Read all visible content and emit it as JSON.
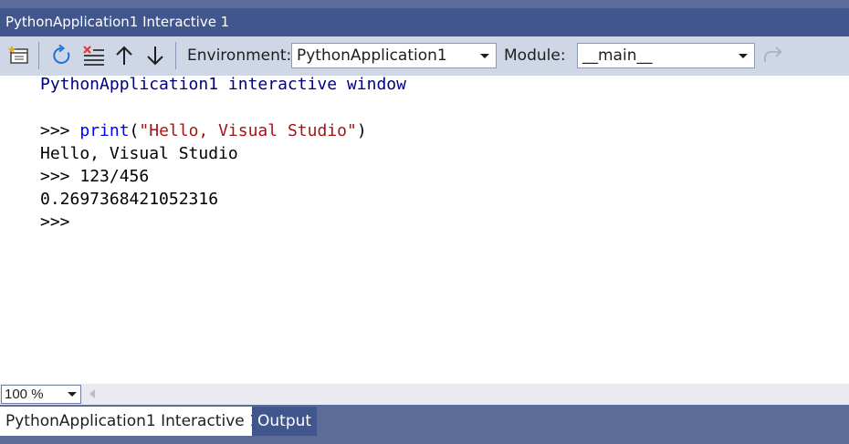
{
  "window": {
    "title": "PythonApplication1 Interactive 1"
  },
  "toolbar": {
    "environment_label": "Environment:",
    "environment_value": "PythonApplication1",
    "module_label": "Module:",
    "module_value": "__main__",
    "icons": [
      "new-window-icon",
      "reset-icon",
      "clear-icon",
      "history-up-icon",
      "history-down-icon",
      "redo-icon"
    ]
  },
  "console": {
    "banner": "PythonApplication1 interactive window",
    "lines": [
      {
        "prompt": ">>> ",
        "func": "print",
        "open": "(",
        "arg": "\"Hello, Visual Studio\"",
        "close": ")"
      },
      {
        "output": "Hello, Visual Studio"
      },
      {
        "prompt": ">>> ",
        "code": "123/456"
      },
      {
        "output": "0.2697368421052316"
      },
      {
        "prompt": ">>>"
      }
    ]
  },
  "status": {
    "zoom": "100 %"
  },
  "tabs": [
    {
      "label": "PythonApplication1 Interactive 1",
      "active": true
    },
    {
      "label": "Output",
      "active": false
    }
  ],
  "colors": {
    "title_bg": "#40568d",
    "toolbar_bg": "#cfd6e5",
    "tabbar_bg": "#5d6b99",
    "keyword": "#0000ff",
    "string": "#a31515",
    "banner": "#00007f",
    "icon_blue": "#1e6fd9",
    "icon_red": "#d83b3b"
  }
}
